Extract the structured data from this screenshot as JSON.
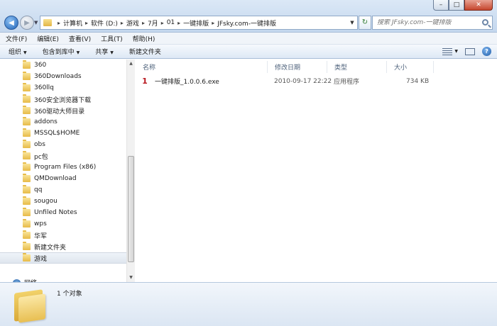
{
  "window": {
    "minimize_symbol": "–",
    "maximize_symbol": "□",
    "close_symbol": "✕"
  },
  "address": {
    "crumbs": [
      "计算机",
      "软件 (D:)",
      "游戏",
      "7月",
      "01",
      "一键排版",
      "JFsky.com-一键排版"
    ],
    "separator": "▸"
  },
  "search": {
    "placeholder": "搜索 JFsky.com-一键排版"
  },
  "menu": [
    "文件(F)",
    "编辑(E)",
    "查看(V)",
    "工具(T)",
    "帮助(H)"
  ],
  "toolbar": {
    "organize": "组织",
    "include_in_library": "包含到库中",
    "share": "共享",
    "new_folder": "新建文件夹"
  },
  "nav_tree": [
    "360",
    "360Downloads",
    "360llq",
    "360安全浏览器下载",
    "360驱动大师目录",
    "addons",
    "MSSQL$HOME",
    "obs",
    "pc包",
    "Program Files (x86)",
    "QMDownload",
    "qq",
    "sougou",
    "Unfiled Notes",
    "wps",
    "华军",
    "新建文件夹",
    "游戏"
  ],
  "selected_tree_item": "游戏",
  "network_label": "网络",
  "columns": {
    "name": "名称",
    "modified": "修改日期",
    "type": "类型",
    "size": "大小"
  },
  "files": [
    {
      "name": "一键排版_1.0.0.6.exe",
      "modified": "2010-09-17 22:22",
      "type": "应用程序",
      "size": "734 KB",
      "icon": "exe-icon",
      "icon_glyph": "1"
    }
  ],
  "details": {
    "count_text": "1 个对象"
  },
  "colors": {
    "selected_tree_bg": "#dfe6ee",
    "exe_icon": "#b8181f",
    "column_header_text": "#4c607a"
  }
}
